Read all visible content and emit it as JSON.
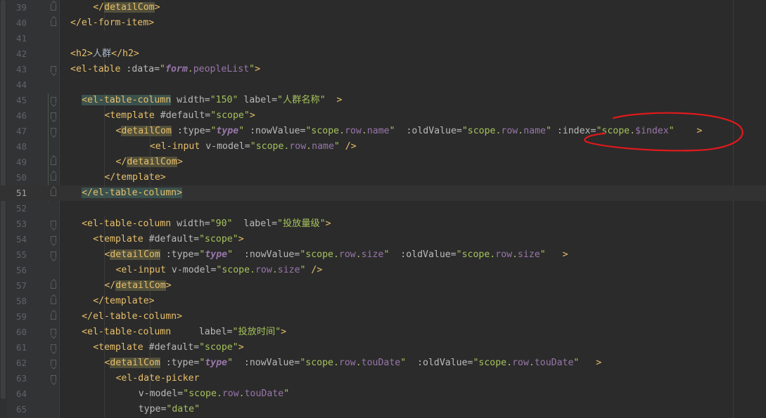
{
  "editor": {
    "lines": [
      {
        "n": "39",
        "indent": 9,
        "fold": "end",
        "tokens": [
          {
            "t": "tag",
            "v": "</"
          },
          {
            "t": "com",
            "v": "detailCom"
          },
          {
            "t": "tag",
            "v": ">"
          }
        ]
      },
      {
        "n": "40",
        "indent": 7,
        "fold": "end",
        "tokens": [
          {
            "t": "tag",
            "v": "</el-form-item>"
          }
        ]
      },
      {
        "n": "41",
        "indent": 0,
        "fold": "none",
        "tokens": []
      },
      {
        "n": "42",
        "indent": 7,
        "fold": "none",
        "tokens": [
          {
            "t": "tag",
            "v": "<h2>"
          },
          {
            "t": "text",
            "v": "人群"
          },
          {
            "t": "tag",
            "v": "</h2>"
          }
        ]
      },
      {
        "n": "43",
        "indent": 7,
        "fold": "start",
        "tokens": [
          {
            "t": "tag",
            "v": "<el-table "
          },
          {
            "t": "attr",
            "v": ":data="
          },
          {
            "t": "str",
            "v": "\""
          },
          {
            "t": "kw",
            "v": "form"
          },
          {
            "t": "str",
            "v": "."
          },
          {
            "t": "strprop",
            "v": "peopleList"
          },
          {
            "t": "str",
            "v": "\""
          },
          {
            "t": "tag",
            "v": ">"
          }
        ]
      },
      {
        "n": "44",
        "indent": 0,
        "fold": "none",
        "tokens": []
      },
      {
        "n": "45",
        "indent": 8,
        "fold": "start",
        "tokens": [
          {
            "t": "taghl",
            "v": "<el-table-column"
          },
          {
            "t": "attr",
            "v": " width="
          },
          {
            "t": "str",
            "v": "\"150\""
          },
          {
            "t": "attr",
            "v": " label="
          },
          {
            "t": "str",
            "v": "\"人群名称\""
          },
          {
            "t": "tag",
            "v": "  >"
          }
        ]
      },
      {
        "n": "46",
        "indent": 10,
        "fold": "start",
        "tokens": [
          {
            "t": "tag",
            "v": "<template "
          },
          {
            "t": "attr",
            "v": "#default="
          },
          {
            "t": "str",
            "v": "\"scope\""
          },
          {
            "t": "tag",
            "v": ">"
          }
        ]
      },
      {
        "n": "47",
        "indent": 11,
        "fold": "start",
        "tokens": [
          {
            "t": "tag",
            "v": "<"
          },
          {
            "t": "com",
            "v": "detailCom"
          },
          {
            "t": "attr",
            "v": " :type="
          },
          {
            "t": "str",
            "v": "\""
          },
          {
            "t": "kw",
            "v": "type"
          },
          {
            "t": "str",
            "v": "\""
          },
          {
            "t": "attr",
            "v": " :nowValue="
          },
          {
            "t": "str",
            "v": "\"scope."
          },
          {
            "t": "strprop",
            "v": "row"
          },
          {
            "t": "str",
            "v": "."
          },
          {
            "t": "strprop",
            "v": "name"
          },
          {
            "t": "str",
            "v": "\""
          },
          {
            "t": "attr",
            "v": "  :oldValue="
          },
          {
            "t": "str",
            "v": "\"scope."
          },
          {
            "t": "strprop",
            "v": "row"
          },
          {
            "t": "str",
            "v": "."
          },
          {
            "t": "strprop",
            "v": "name"
          },
          {
            "t": "str",
            "v": "\""
          },
          {
            "t": "attr",
            "v": " :index="
          },
          {
            "t": "str",
            "v": "\"scope."
          },
          {
            "t": "strprop",
            "v": "$index"
          },
          {
            "t": "str",
            "v": "\""
          },
          {
            "t": "tag",
            "v": "    >"
          }
        ]
      },
      {
        "n": "48",
        "indent": 14,
        "fold": "none",
        "tokens": [
          {
            "t": "tag",
            "v": "<el-input "
          },
          {
            "t": "attr",
            "v": "v-model="
          },
          {
            "t": "str",
            "v": "\"scope."
          },
          {
            "t": "strprop",
            "v": "row"
          },
          {
            "t": "str",
            "v": "."
          },
          {
            "t": "strprop",
            "v": "name"
          },
          {
            "t": "str",
            "v": "\""
          },
          {
            "t": "tag",
            "v": " />"
          }
        ]
      },
      {
        "n": "49",
        "indent": 11,
        "fold": "end",
        "tokens": [
          {
            "t": "tag",
            "v": "</"
          },
          {
            "t": "com",
            "v": "detailCom"
          },
          {
            "t": "tag",
            "v": ">"
          }
        ]
      },
      {
        "n": "50",
        "indent": 10,
        "fold": "end",
        "tokens": [
          {
            "t": "tag",
            "v": "</template>"
          }
        ]
      },
      {
        "n": "51",
        "indent": 8,
        "fold": "end",
        "current": true,
        "tokens": [
          {
            "t": "taghl",
            "v": "</el-table-column>"
          }
        ]
      },
      {
        "n": "52",
        "indent": 0,
        "fold": "none",
        "tokens": []
      },
      {
        "n": "53",
        "indent": 8,
        "fold": "start",
        "tokens": [
          {
            "t": "tag",
            "v": "<el-table-column "
          },
          {
            "t": "attr",
            "v": "width="
          },
          {
            "t": "str",
            "v": "\"90\""
          },
          {
            "t": "attr",
            "v": "  label="
          },
          {
            "t": "str",
            "v": "\"投放量级\""
          },
          {
            "t": "tag",
            "v": ">"
          }
        ]
      },
      {
        "n": "54",
        "indent": 9,
        "fold": "start",
        "tokens": [
          {
            "t": "tag",
            "v": "<template "
          },
          {
            "t": "attr",
            "v": "#default="
          },
          {
            "t": "str",
            "v": "\"scope\""
          },
          {
            "t": "tag",
            "v": ">"
          }
        ]
      },
      {
        "n": "55",
        "indent": 10,
        "fold": "start",
        "tokens": [
          {
            "t": "tag",
            "v": "<"
          },
          {
            "t": "com",
            "v": "detailCom"
          },
          {
            "t": "attr",
            "v": " :type="
          },
          {
            "t": "str",
            "v": "\""
          },
          {
            "t": "kw",
            "v": "type"
          },
          {
            "t": "str",
            "v": "\""
          },
          {
            "t": "attr",
            "v": "  :nowValue="
          },
          {
            "t": "str",
            "v": "\"scope."
          },
          {
            "t": "strprop",
            "v": "row"
          },
          {
            "t": "str",
            "v": "."
          },
          {
            "t": "strprop",
            "v": "size"
          },
          {
            "t": "str",
            "v": "\""
          },
          {
            "t": "attr",
            "v": "  :oldValue="
          },
          {
            "t": "str",
            "v": "\"scope."
          },
          {
            "t": "strprop",
            "v": "row"
          },
          {
            "t": "str",
            "v": "."
          },
          {
            "t": "strprop",
            "v": "size"
          },
          {
            "t": "str",
            "v": "\""
          },
          {
            "t": "tag",
            "v": "   >"
          }
        ]
      },
      {
        "n": "56",
        "indent": 11,
        "fold": "none",
        "tokens": [
          {
            "t": "tag",
            "v": "<el-input "
          },
          {
            "t": "attr",
            "v": "v-model="
          },
          {
            "t": "str",
            "v": "\"scope."
          },
          {
            "t": "strprop",
            "v": "row"
          },
          {
            "t": "str",
            "v": "."
          },
          {
            "t": "strprop",
            "v": "size"
          },
          {
            "t": "str",
            "v": "\""
          },
          {
            "t": "tag",
            "v": " />"
          }
        ]
      },
      {
        "n": "57",
        "indent": 10,
        "fold": "end",
        "tokens": [
          {
            "t": "tag",
            "v": "</"
          },
          {
            "t": "com",
            "v": "detailCom"
          },
          {
            "t": "tag",
            "v": ">"
          }
        ]
      },
      {
        "n": "58",
        "indent": 9,
        "fold": "end",
        "tokens": [
          {
            "t": "tag",
            "v": "</template>"
          }
        ]
      },
      {
        "n": "59",
        "indent": 8,
        "fold": "end",
        "tokens": [
          {
            "t": "tag",
            "v": "</el-table-column>"
          }
        ]
      },
      {
        "n": "60",
        "indent": 8,
        "fold": "start",
        "tokens": [
          {
            "t": "tag",
            "v": "<el-table-column "
          },
          {
            "t": "attr",
            "v": "    label="
          },
          {
            "t": "str",
            "v": "\"投放时间\""
          },
          {
            "t": "tag",
            "v": ">"
          }
        ]
      },
      {
        "n": "61",
        "indent": 9,
        "fold": "start",
        "tokens": [
          {
            "t": "tag",
            "v": "<template "
          },
          {
            "t": "attr",
            "v": "#default="
          },
          {
            "t": "str",
            "v": "\"scope\""
          },
          {
            "t": "tag",
            "v": ">"
          }
        ]
      },
      {
        "n": "62",
        "indent": 10,
        "fold": "start",
        "tokens": [
          {
            "t": "tag",
            "v": "<"
          },
          {
            "t": "com",
            "v": "detailCom"
          },
          {
            "t": "attr",
            "v": " :type="
          },
          {
            "t": "str",
            "v": "\""
          },
          {
            "t": "kw",
            "v": "type"
          },
          {
            "t": "str",
            "v": "\""
          },
          {
            "t": "attr",
            "v": "  :nowValue="
          },
          {
            "t": "str",
            "v": "\"scope."
          },
          {
            "t": "strprop",
            "v": "row"
          },
          {
            "t": "str",
            "v": "."
          },
          {
            "t": "strprop",
            "v": "touDate"
          },
          {
            "t": "str",
            "v": "\""
          },
          {
            "t": "attr",
            "v": "  :oldValue="
          },
          {
            "t": "str",
            "v": "\"scope."
          },
          {
            "t": "strprop",
            "v": "row"
          },
          {
            "t": "str",
            "v": "."
          },
          {
            "t": "strprop",
            "v": "touDate"
          },
          {
            "t": "str",
            "v": "\""
          },
          {
            "t": "tag",
            "v": "   >"
          }
        ]
      },
      {
        "n": "63",
        "indent": 11,
        "fold": "start",
        "tokens": [
          {
            "t": "tag",
            "v": "<el-date-picker"
          }
        ]
      },
      {
        "n": "64",
        "indent": 13,
        "fold": "none",
        "tokens": [
          {
            "t": "attr",
            "v": "v-model="
          },
          {
            "t": "str",
            "v": "\"scope."
          },
          {
            "t": "strprop",
            "v": "row"
          },
          {
            "t": "str",
            "v": "."
          },
          {
            "t": "strprop",
            "v": "touDate"
          },
          {
            "t": "str",
            "v": "\""
          }
        ]
      },
      {
        "n": "65",
        "indent": 13,
        "fold": "none",
        "tokens": [
          {
            "t": "attr",
            "v": "type="
          },
          {
            "t": "str",
            "v": "\"date\""
          }
        ]
      }
    ]
  },
  "colors": {
    "background": "#2b2b2b",
    "annotation": "#e0191c"
  }
}
